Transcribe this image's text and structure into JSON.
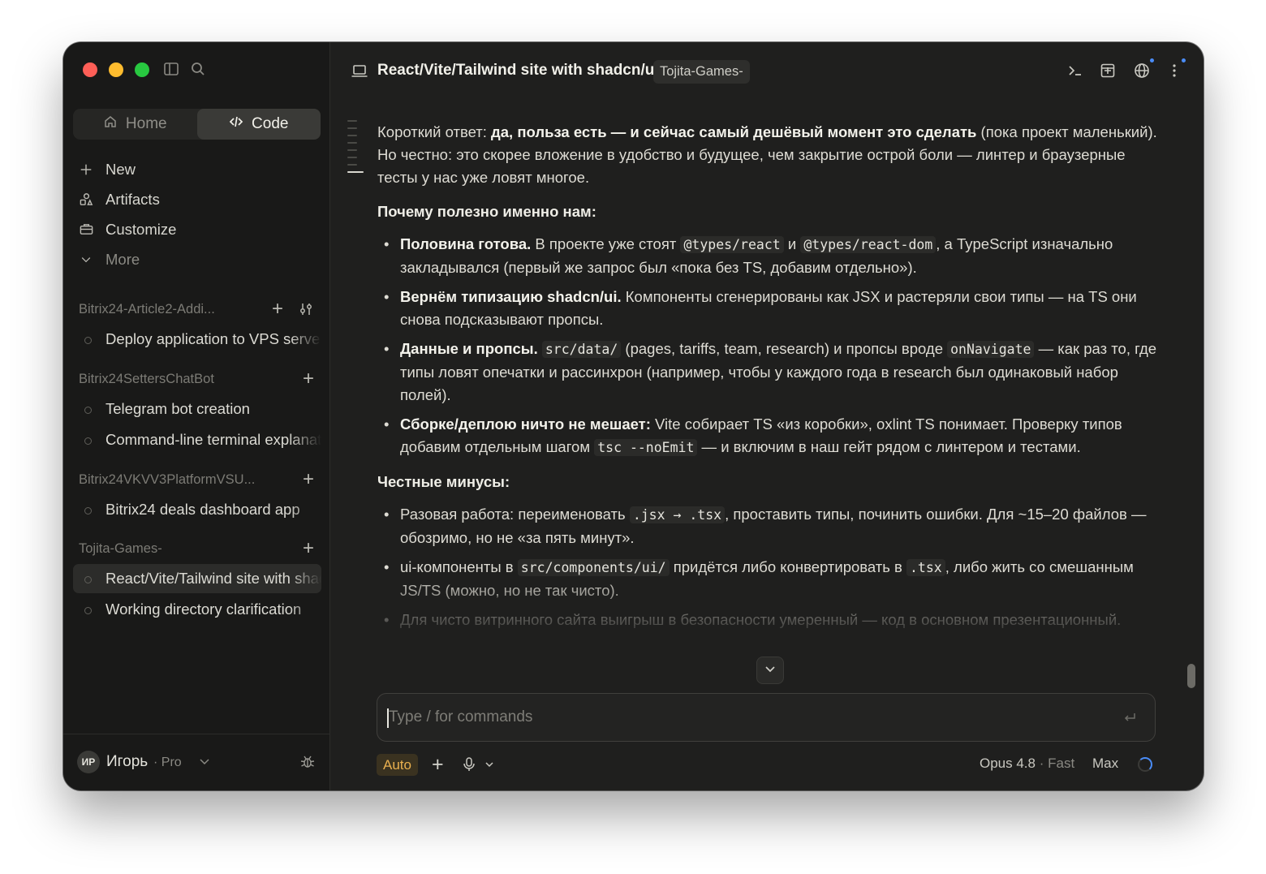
{
  "sidebar": {
    "tabs": [
      {
        "label": "Home",
        "icon": "home-icon",
        "active": false
      },
      {
        "label": "Code",
        "icon": "code-icon",
        "active": true
      }
    ],
    "nav": [
      {
        "label": "New",
        "icon": "plus-icon"
      },
      {
        "label": "Artifacts",
        "icon": "artifacts-icon"
      },
      {
        "label": "Customize",
        "icon": "briefcase-icon"
      },
      {
        "label": "More",
        "icon": "chevron-down-icon"
      }
    ],
    "groups": [
      {
        "name": "Bitrix24-Article2-Addi...",
        "threads": [
          "Deploy application to VPS server"
        ]
      },
      {
        "name": "Bitrix24SettersChatBot",
        "threads": [
          "Telegram bot creation",
          "Command-line terminal explanation"
        ]
      },
      {
        "name": "Bitrix24VKVV3PlatformVSU...",
        "threads": [
          "Bitrix24 deals dashboard app"
        ]
      },
      {
        "name": "Tojita-Games-",
        "threads": [
          "React/Vite/Tailwind site with shadcn/ui",
          "Working directory clarification"
        ]
      }
    ],
    "user": {
      "initials": "ИР",
      "name": "Игорь",
      "plan": "· Pro"
    }
  },
  "header": {
    "title": "React/Vite/Tailwind site with shadcn/ui",
    "tag": "Tojita-Games-"
  },
  "message": {
    "intro_pre": "Короткий ответ: ",
    "intro_bold": "да, польза есть — и сейчас самый дешёвый момент это сделать",
    "intro_post": " (пока проект маленький). Но честно: это скорее вложение в удобство и будущее, чем закрытие острой боли — линтер и браузерные тесты у нас уже ловят многое.",
    "why_heading": "Почему полезно именно нам:",
    "b1_bold": "Половина готова.",
    "b1_t1": " В проекте уже стоят ",
    "b1_c1": "@types/react",
    "b1_t2": " и ",
    "b1_c2": "@types/react-dom",
    "b1_t3": ", а TypeScript изначально закладывался (первый же запрос был «пока без TS, добавим отдельно»).",
    "b2_bold": "Вернём типизацию shadcn/ui.",
    "b2_t1": " Компоненты сгенерированы как JSX и растеряли свои типы — на TS они снова подсказывают пропсы.",
    "b3_bold": "Данные и пропсы.",
    "b3_c1": "src/data/",
    "b3_t1": " (pages, tariffs, team, research) и пропсы вроде ",
    "b3_c2": "onNavigate",
    "b3_t2": " — как раз то, где типы ловят опечатки и рассинхрон (например, чтобы у каждого года в research был одинаковый набор полей).",
    "b4_bold": "Сборке/деплою ничто не мешает:",
    "b4_t1": " Vite собирает TS «из коробки», oxlint TS понимает. Проверку типов добавим отдельным шагом ",
    "b4_c1": "tsc --noEmit",
    "b4_t2": " — и включим в наш гейт рядом с линтером и тестами.",
    "cons_heading": "Честные минусы:",
    "m1_t1": "Разовая работа: переименовать ",
    "m1_c1": ".jsx → .tsx",
    "m1_t2": ", проставить типы, починить ошибки. Для ~15–20 файлов — обозримо, но не «за пять минут».",
    "m2_t1": "ui-компоненты в ",
    "m2_c1": "src/components/ui/",
    "m2_t2": " придётся либо конвертировать в ",
    "m2_c2": ".tsx",
    "m2_t3": ", либо жить со смешанным JS/TS (можно, но не так чисто).",
    "m3_t1": "Для чисто витринного сайта выигрыш в безопасности умеренный — код в основном презентационный."
  },
  "composer": {
    "placeholder": "Type / for commands",
    "mode": "Auto",
    "model": "Opus 4.8",
    "speed": "· Fast",
    "effort": "Max"
  },
  "colors": {
    "accent_blue": "#4a8cf7",
    "auto_badge": "#e9b04f"
  }
}
